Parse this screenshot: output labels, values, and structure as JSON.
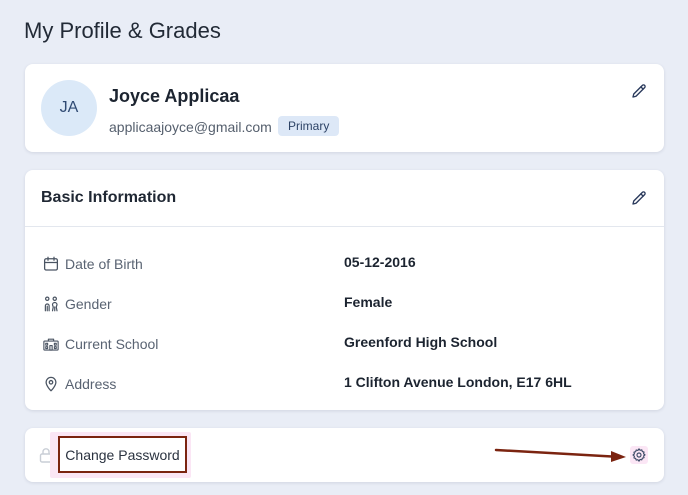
{
  "page": {
    "title": "My Profile & Grades"
  },
  "profile": {
    "initials": "JA",
    "name": "Joyce Applicaa",
    "email": "applicaajoyce@gmail.com",
    "badge": "Primary",
    "edit_icon": "pencil-icon"
  },
  "basic_info": {
    "title": "Basic Information",
    "edit_icon": "pencil-icon",
    "rows": [
      {
        "icon": "calendar-icon",
        "label": "Date of Birth",
        "value": "05-12-2016"
      },
      {
        "icon": "people-icon",
        "label": "Gender",
        "value": "Female"
      },
      {
        "icon": "school-icon",
        "label": "Current School",
        "value": "Greenford High School"
      },
      {
        "icon": "location-pin-icon",
        "label": "Address",
        "value": "1 Clifton Avenue  London, E17 6HL"
      }
    ]
  },
  "security": {
    "lock_icon": "lock-icon",
    "change_password_label": "Change Password",
    "settings_icon": "gear-icon"
  },
  "colors": {
    "background": "#e9edf6",
    "card": "#ffffff",
    "avatar_bg": "#dbe9f8",
    "badge_bg": "#dde8f7",
    "highlight": "#fbe6f5",
    "annotation": "#7b2410"
  }
}
